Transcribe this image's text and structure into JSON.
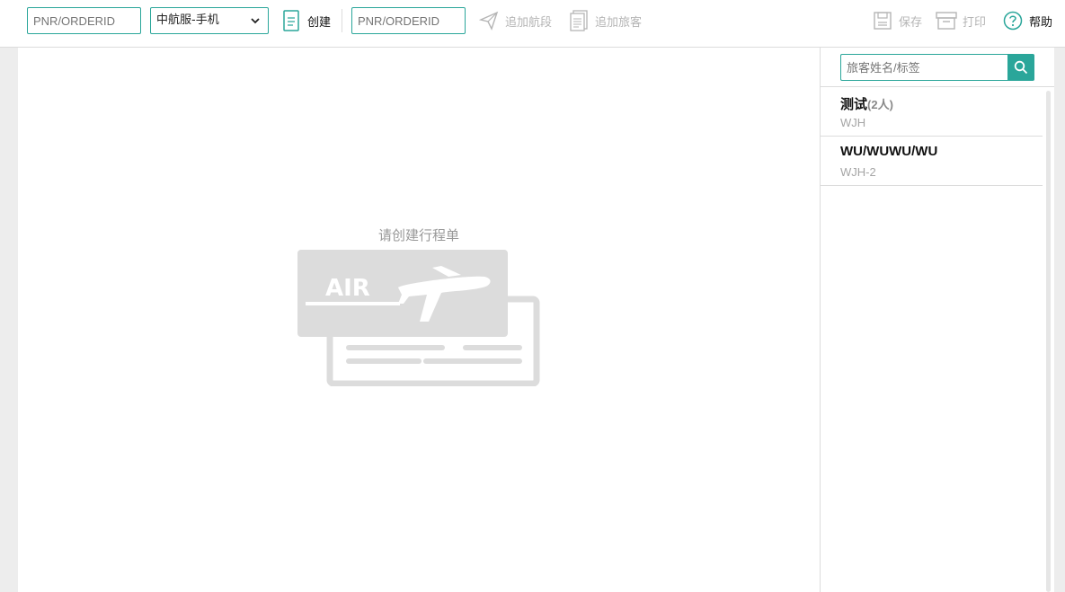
{
  "toolbar": {
    "pnr_input_1": {
      "placeholder": "PNR/ORDERID",
      "value": ""
    },
    "channel_select": {
      "selected": "中航服-手机"
    },
    "create_label": "创建",
    "pnr_input_2": {
      "placeholder": "PNR/ORDERID",
      "value": ""
    },
    "add_segment_label": "追加航段",
    "add_passenger_label": "追加旅客",
    "save_label": "保存",
    "print_label": "打印",
    "help_label": "帮助"
  },
  "main": {
    "empty_message": "请创建行程单",
    "illustration": {
      "text": "AIR",
      "icon": "airplane-ticket-icon"
    }
  },
  "passenger_panel": {
    "search": {
      "placeholder": "旅客姓名/标签",
      "value": "",
      "icon": "search-icon"
    },
    "items": [
      {
        "name": "测试",
        "count": "(2人)",
        "tag": "WJH"
      },
      {
        "name": "WU/WUWU/WU",
        "count": "",
        "tag": "WJH-2"
      }
    ]
  },
  "colors": {
    "accent": "#2aa69a",
    "disabled": "#b5b5b5",
    "illustration": "#dcdcdc"
  }
}
